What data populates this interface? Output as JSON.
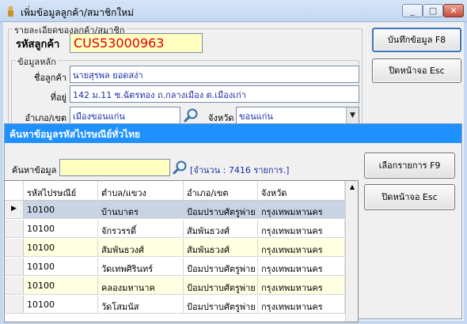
{
  "window": {
    "title": "เพิ่มข้อมูลลูกค้า/สมาชิกใหม่"
  },
  "customer_group": {
    "legend": "รายละเอียดของลูกค้า/สมาชิก",
    "code_label": "รหัสลูกค้า",
    "code_value": "CUS53000963"
  },
  "main_group": {
    "legend": "ข้อมูลหลัก",
    "name_label": "ชื่อลูกค้า",
    "name_value": "นายสุรพล ยอดสง่า",
    "address_label": "ที่อยู่",
    "address_value": "142 ม.11 ซ.ฉัตรทอง ถ.กลางเมือง ต.เมืองเก่า",
    "district_label": "อำเภอ/เขต",
    "district_value": "เมืองขอนแก่น",
    "province_label": "จังหวัด",
    "province_value": "ขอนแก่น"
  },
  "buttons": {
    "save": "บันทึกข้อมูล F8",
    "close": "ปิดหน้าจอ Esc"
  },
  "dialog": {
    "title": "ค้นหาข้อมูลรหัสไปรษณีย์ทั่วไทย",
    "search_label": "ค้นหาข้อมูล",
    "search_value": "",
    "count_text": "[จำนวน : 7416 รายการ.]",
    "select_button": "เลือกรายการ F9",
    "close_button": "ปิดหน้าจอ Esc",
    "columns": [
      "รหัสไปรษณีย์",
      "ตำบล/แขวง",
      "อำเภอ/เขต",
      "จังหวัด"
    ],
    "rows": [
      {
        "zip": "10100",
        "subdistrict": "บ้านบาตร",
        "district": "ป้อมปราบศัตรูพ่าย",
        "province": "กรุงเทพมหานคร"
      },
      {
        "zip": "10100",
        "subdistrict": "จักรวรรดิ์",
        "district": "สัมพันธวงศ์",
        "province": "กรุงเทพมหานคร"
      },
      {
        "zip": "10100",
        "subdistrict": "สัมพันธวงศ์",
        "district": "สัมพันธวงศ์",
        "province": "กรุงเทพมหานคร"
      },
      {
        "zip": "10100",
        "subdistrict": "วัดเทพศิรินทร์",
        "district": "ป้อมปราบศัตรูพ่าย",
        "province": "กรุงเทพมหานคร"
      },
      {
        "zip": "10100",
        "subdistrict": "คลองมหานาค",
        "district": "ป้อมปราบศัตรูพ่าย",
        "province": "กรุงเทพมหานคร"
      },
      {
        "zip": "10100",
        "subdistrict": "วัดโสมนัส",
        "district": "ป้อมปราบศัตรูพ่าย",
        "province": "กรุงเทพมหานคร"
      }
    ]
  },
  "colors": {
    "dialog_header": "#1e90ff",
    "selected_row": "#c8d4e4",
    "alt_row": "#ffffe1",
    "code_text": "#e00000"
  }
}
